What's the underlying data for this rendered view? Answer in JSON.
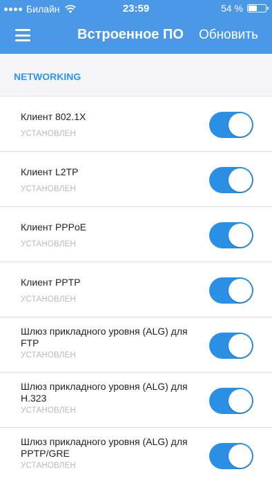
{
  "status_bar": {
    "carrier": "Билайн",
    "time": "23:59",
    "battery_text": "54 %",
    "battery_level": 0.54
  },
  "header": {
    "title": "Встроенное ПО",
    "refresh_label": "Обновить",
    "background_color": "#4a98e6"
  },
  "section": {
    "title": "NETWORKING",
    "color": "#2f95e8"
  },
  "toggle_color": "#2b90e3",
  "items": [
    {
      "name": "Клиент 802.1X",
      "status": "УСТАНОВЛЕН",
      "enabled": true
    },
    {
      "name": "Клиент L2TP",
      "status": "УСТАНОВЛЕН",
      "enabled": true
    },
    {
      "name": "Клиент PPPoE",
      "status": "УСТАНОВЛЕН",
      "enabled": true
    },
    {
      "name": "Клиент PPTP",
      "status": "УСТАНОВЛЕН",
      "enabled": true
    },
    {
      "name": "Шлюз прикладного уровня (ALG) для FTP",
      "status": "УСТАНОВЛЕН",
      "enabled": true
    },
    {
      "name": "Шлюз прикладного уровня (ALG) для H.323",
      "status": "УСТАНОВЛЕН",
      "enabled": true
    },
    {
      "name": "Шлюз прикладного уровня (ALG) для PPTP/GRE",
      "status": "УСТАНОВЛЕН",
      "enabled": true
    }
  ]
}
